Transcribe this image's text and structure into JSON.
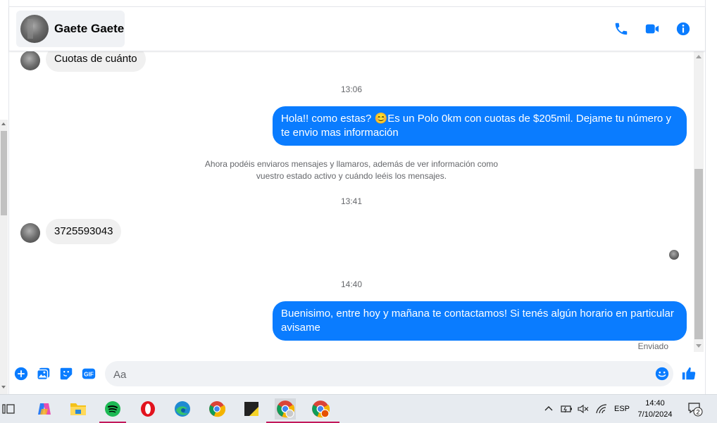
{
  "header": {
    "contact_name": "Gaete Gaete",
    "icons": [
      "phone-icon",
      "video-icon",
      "info-icon"
    ],
    "accent_color": "#0a7cff"
  },
  "messages": {
    "partial_incoming": "Cuotas de cuánto",
    "time1": "13:06",
    "outgoing1": "Hola!! como estas? 😊Es un Polo 0km con cuotas de $205mil. Dejame tu número y te envio mas información",
    "notice": "Ahora podéis enviaros mensajes y llamaros, además de ver información como vuestro estado activo y cuándo leéis los mensajes.",
    "time2": "13:41",
    "incoming_phone": "3725593043",
    "time3": "14:40",
    "outgoing2": "Buenisimo, entre hoy y mañana te contactamos! Si tenés algún horario en particular avisame",
    "status": "Enviado"
  },
  "composer": {
    "placeholder": "Aa",
    "value": "",
    "icons": [
      "plus-icon",
      "image-icon",
      "sticker-icon",
      "gif-icon",
      "emoji-icon",
      "like-icon"
    ],
    "gif_label": "GIF"
  },
  "taskbar": {
    "apps": [
      "task-view-icon",
      "copilot-icon",
      "file-explorer-icon",
      "spotify-icon",
      "opera-icon",
      "edge-icon",
      "chrome-icon",
      "sticky-notes-icon",
      "chrome-profile-1-icon",
      "chrome-profile-2-icon"
    ],
    "language": "ESP",
    "time": "14:40",
    "date": "7/10/2024",
    "notification_count": "2"
  }
}
